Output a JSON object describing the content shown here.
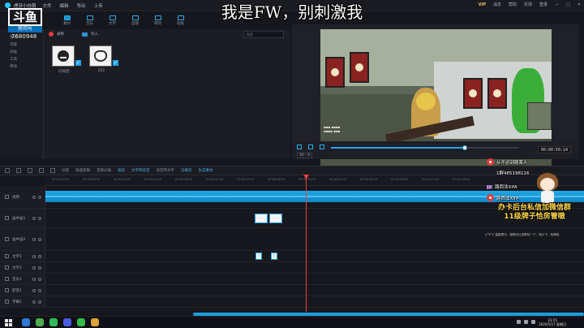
{
  "caption": "我是FW，别刺激我",
  "watermark": {
    "logo": "斗鱼",
    "sub": "房间号",
    "room": "7680948"
  },
  "titlebar": {
    "app_title": "虎牙小白剪",
    "menu": [
      "文件",
      "编辑",
      "导出",
      "上传"
    ],
    "right": [
      "VIP",
      "消息",
      "帮助",
      "反馈",
      "登录"
    ]
  },
  "toolbar": {
    "items": [
      "素材",
      "音乐",
      "文字",
      "滤镜",
      "转场",
      "贴纸"
    ]
  },
  "leftnav": {
    "items": [
      "我的",
      "可能",
      "动画",
      "工具",
      "特效"
    ]
  },
  "library": {
    "record_label": "录制",
    "import_label": "导入",
    "search_placeholder": "搜索",
    "thumbs": [
      {
        "label": "问号脸"
      },
      {
        "label": "222"
      }
    ]
  },
  "preview": {
    "progress": 0.71,
    "timecode": "00:00:50:14",
    "ratio": "16 : 9",
    "hud": [
      "▪▪▪ ▪▪▪▪",
      "▪▪▪▪ ▪▪▪"
    ]
  },
  "timeline_toolbar": [
    "撤销",
    "重做",
    "剪切",
    "复制",
    "删除",
    "分割",
    "快速剪辑",
    "音频分离",
    "裁剪",
    "文字转语音",
    "语音转文字",
    "马赛克",
    "生成素材"
  ],
  "ruler": [
    "00:00:23:10",
    "00:00:26:20",
    "00:00:30:00",
    "00:00:33:10",
    "00:00:36:20",
    "00:00:40:00",
    "00:00:43:10",
    "00:00:46:20",
    "00:00:50:00",
    "00:00:53:10",
    "00:00:56:20",
    "00:01:00:00",
    "00:01:03:10",
    "00:01:06:20"
  ],
  "tracks": [
    {
      "label": "视频",
      "kind": "video"
    },
    {
      "label": "画中画1",
      "kind": "pip"
    },
    {
      "label": "画中画2",
      "kind": "pip"
    },
    {
      "label": "文字1",
      "kind": "text"
    },
    {
      "label": "文字2",
      "kind": "text"
    },
    {
      "label": "音乐1",
      "kind": "audio"
    },
    {
      "label": "配音1",
      "kind": "audio"
    },
    {
      "label": "字幕1",
      "kind": "subtitle"
    }
  ],
  "chat": {
    "lines": [
      {
        "text": "从不迟到路某人"
      },
      {
        "text": "1群485198116"
      },
      {
        "level": "UL",
        "text": "路西法XifA"
      },
      {
        "text": "路西法XifA"
      }
    ],
    "promo1": "办卡后台私信加微信群",
    "promo2": "11级牌子恰房管嗷",
    "tiny": "\\(°∀°)/ 温馨提示，喵喵可以进群玩一下，晓么下，晓事晓"
  },
  "taskbar": {
    "time": "23:55",
    "date": "2020/5/17 星期日"
  }
}
